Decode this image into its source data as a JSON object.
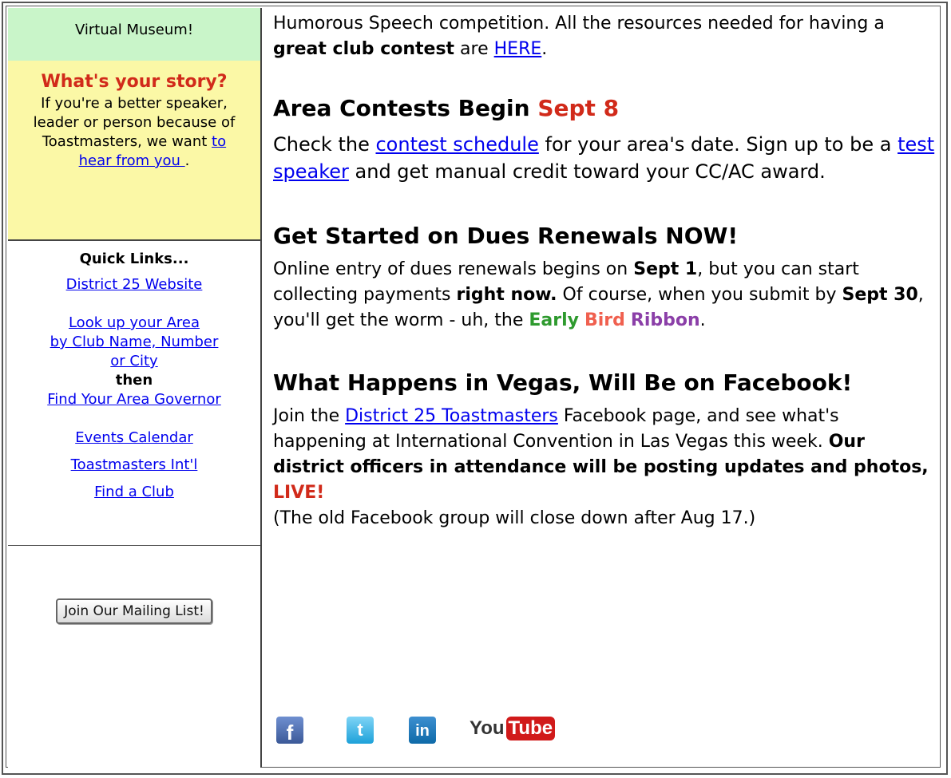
{
  "sidebar": {
    "museum_label": "Virtual Museum!",
    "story": {
      "title": "What's your story?",
      "text": "If you're a better speaker, leader or person because of Toastmasters, we want",
      "link": "to hear from you ",
      "period": "."
    },
    "quick_links": {
      "title": "Quick Links...",
      "district_website": "District 25 Website",
      "lookup_area_line1": "Look up your Area",
      "lookup_area_line2": "by Club Name, Number",
      "lookup_area_line3": "or City",
      "then": "then",
      "find_governor": "Find Your Area Governor",
      "events_calendar": "Events Calendar",
      "toastmasters_intl": "Toastmasters Int'l ",
      "find_club": "Find a Club"
    },
    "join_button": "Join Our Mailing List!"
  },
  "main": {
    "intro": {
      "pre": "Humorous Speech competition. All the resources needed for having a ",
      "bold": "great club contest",
      "mid": " are ",
      "link": "HERE",
      "post": "."
    },
    "area_contests": {
      "heading": "Area Contests Begin ",
      "heading_date": "Sept 8",
      "p1": "Check the ",
      "link1": "contest schedule",
      "p2": " for your area's date. Sign up to be a ",
      "link2": "test speaker",
      "p3": " and get manual credit toward your CC/AC award."
    },
    "dues": {
      "heading": "Get Started on Dues Renewals NOW!",
      "p1": "Online entry of dues renewals begins on ",
      "b1": "Sept 1",
      "p2": ", but you can start collecting payments ",
      "b2": "right now.",
      "p3": " Of course, when you submit by ",
      "b3": "Sept 30",
      "p4": ", you'll get the worm - uh, the ",
      "early": "Early",
      "bird": "Bird",
      "ribbon": "Ribbon",
      "p5": "."
    },
    "vegas": {
      "heading": "What Happens in Vegas, Will Be on Facebook!",
      "p1": "Join the ",
      "link": "District 25 Toastmasters",
      "p2": " Facebook page, and see what's happening at International Convention in Las Vegas this week. ",
      "bold": "Our district officers in attendance will be posting updates and photos, ",
      "live": "LIVE!",
      "note": "(The old Facebook group will close down after Aug 17.)"
    }
  },
  "social": {
    "facebook": "f",
    "twitter": "t",
    "linkedin": "in",
    "youtube_you": "You",
    "youtube_tube": "Tube"
  }
}
